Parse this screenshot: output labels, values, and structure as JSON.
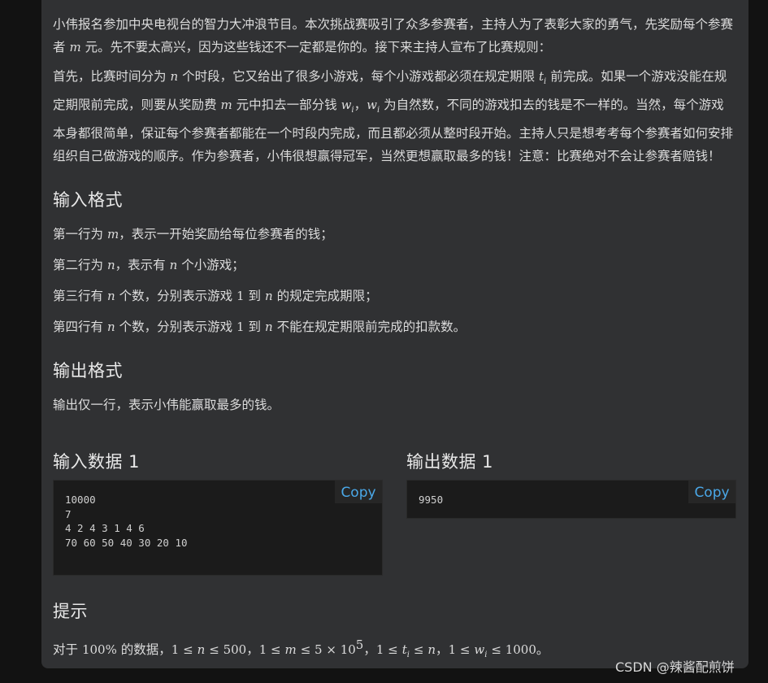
{
  "description": {
    "p1_a": "小伟报名参加中央电视台的智力大冲浪节目。本次挑战赛吸引了众多参赛者，主持人为了表彰大家的勇气，先奖励每个参赛者",
    "p1_var": "m",
    "p1_b": "元。先不要太高兴，因为这些钱还不一定都是你的。接下来主持人宣布了比赛规则：",
    "p2_a": "首先，比赛时间分为",
    "p2_var_n": "n",
    "p2_b": "个时段，它又给出了很多小游戏，每个小游戏都必须在规定期限",
    "p2_var_t": "t",
    "p2_sub_i": "i",
    "p2_c": "前完成。如果一个游戏没能在规定期限前完成，则要从奖励费",
    "p2_var_m": "m",
    "p2_d": "元中扣去一部分钱",
    "p2_var_w": "w",
    "p2_sep": "，",
    "p2_var_w2": "w",
    "p2_e": "为自然数，不同的游戏扣去的钱是不一样的。当然，每个游戏本身都很简单，保证每个参赛者都能在一个时段内完成，而且都必须从整时段开始。主持人只是想考考每个参赛者如何安排组织自己做游戏的顺序。作为参赛者，小伟很想赢得冠军，当然更想赢取最多的钱！注意：比赛绝对不会让参赛者赔钱！"
  },
  "input_format": {
    "title": "输入格式",
    "line1_a": "第一行为",
    "line1_var": "m",
    "line1_b": "，表示一开始奖励给每位参赛者的钱；",
    "line2_a": "第二行为",
    "line2_var": "n",
    "line2_b": "，表示有",
    "line2_var2": "n",
    "line2_c": "个小游戏；",
    "line3_a": "第三行有",
    "line3_var": "n",
    "line3_b": "个数，分别表示游戏",
    "line3_one": "1",
    "line3_c": "到",
    "line3_var2": "n",
    "line3_d": "的规定完成期限；",
    "line4_a": "第四行有",
    "line4_var": "n",
    "line4_b": "个数，分别表示游戏",
    "line4_one": "1",
    "line4_c": "到",
    "line4_var2": "n",
    "line4_d": "不能在规定期限前完成的扣款数。"
  },
  "output_format": {
    "title": "输出格式",
    "line1": "输出仅一行，表示小伟能赢取最多的钱。"
  },
  "sample_input": {
    "title": "输入数据 1",
    "code": "10000\n7\n4 2 4 3 1 4 6\n70 60 50 40 30 20 10",
    "copy_label": "Copy"
  },
  "sample_output": {
    "title": "输出数据 1",
    "code": "9950",
    "copy_label": "Copy"
  },
  "hint": {
    "title": "提示",
    "a": "对于",
    "pct": "100%",
    "b": "的数据，",
    "c1": "1 ≤",
    "c1v": "n",
    "c1e": "≤ 500",
    "sep1": "，",
    "c2": "1 ≤",
    "c2v": "m",
    "c2e": "≤ 5 × 10",
    "c2sup": "5",
    "sep2": "，",
    "c3": "1 ≤",
    "c3v": "t",
    "c3sub": "i",
    "c3e": "≤",
    "c3v2": "n",
    "sep3": "，",
    "c4": "1 ≤",
    "c4v": "w",
    "c4sub": "i",
    "c4e": "≤ 1000",
    "end": "。"
  },
  "watermark": "CSDN @辣酱配煎饼"
}
